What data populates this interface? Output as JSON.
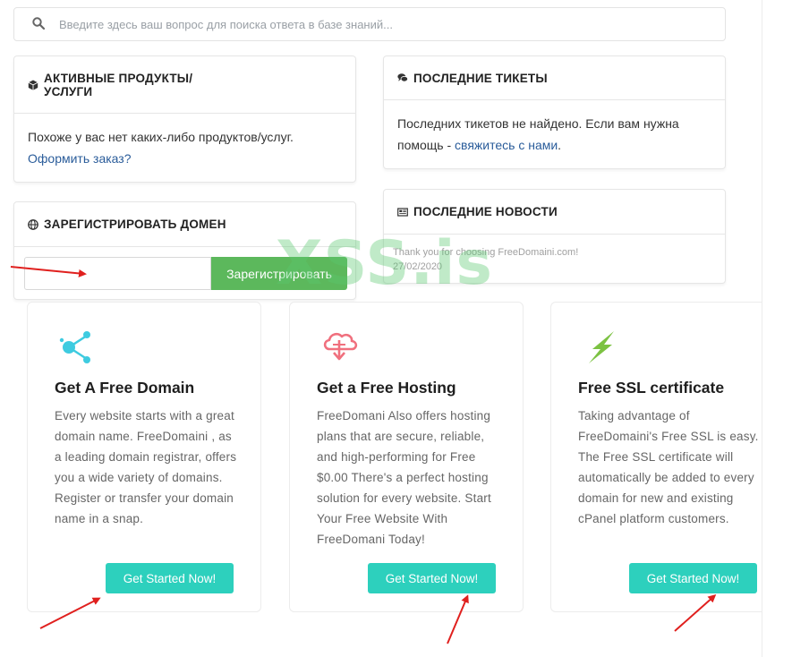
{
  "search": {
    "placeholder": "Введите здесь ваш вопрос для поиска ответа в базе знаний..."
  },
  "products_panel": {
    "title": "Активные продукты/ услуги",
    "message": "Похоже у вас нет каких-либо продуктов/услуг.",
    "order_link": "Оформить заказ?"
  },
  "tickets_panel": {
    "title": "Последние тикеты",
    "message": "Последних тикетов не найдено. Если вам нужна помощь -",
    "contact_link": "свяжитесь с нами",
    "end": "."
  },
  "domain_panel": {
    "title": "Зарегистрировать домен",
    "input_value": "",
    "register_button": "Зарегистрировать"
  },
  "news_panel": {
    "title": "Последние новости",
    "item_text": "Thank you for choosing FreeDomaini.com!",
    "item_date": "27/02/2020"
  },
  "watermark": "XSS.is",
  "cards": [
    {
      "icon": "share-network-icon",
      "icon_color": "#3ecbe0",
      "title": "Get A Free Domain",
      "text": "Every website starts with a great domain name. FreeDomaini , as a leading domain registrar, offers you a wide variety of domains. Register or transfer your domain name in a snap.",
      "button": "Get Started Now!"
    },
    {
      "icon": "cloud-download-icon",
      "icon_color": "#f0707e",
      "title": "Get a Free Hosting",
      "text": "FreeDomani Also offers hosting plans that are secure, reliable, and high-performing for Free $0.00 There's a perfect hosting solution for every website. Start Your Free Website With FreeDomani Today!",
      "button": "Get Started Now!"
    },
    {
      "icon": "lightning-bolt-icon",
      "icon_color": "#7cc242",
      "title": "Free SSL certificate",
      "text": "Taking advantage of FreeDomaini's Free SSL is easy. The Free SSL certificate will automatically be added to every domain for new and existing cPanel platform customers.",
      "button": "Get Started Now!"
    }
  ],
  "colors": {
    "accent_teal": "#2dd0bd",
    "register_green": "#5cb85c",
    "link_blue": "#2a5c9a",
    "arrow_red": "#e0201e"
  }
}
